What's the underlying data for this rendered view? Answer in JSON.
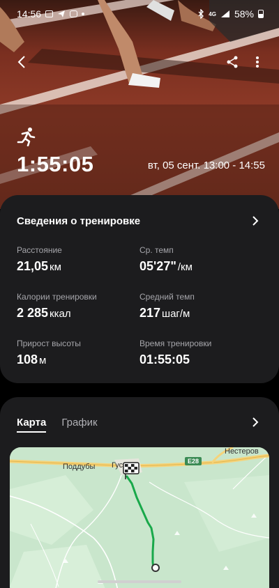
{
  "status_bar": {
    "time": "14:56",
    "signal_text": "4G",
    "battery_percent": "58%"
  },
  "header": {
    "back_icon": "back-arrow-icon",
    "share_icon": "share-icon",
    "more_icon": "more-vertical-icon",
    "activity_icon": "running-icon"
  },
  "workout": {
    "duration": "1:55:05",
    "datetime": "вт, 05 сент. 13:00 - 14:55"
  },
  "summary": {
    "title": "Сведения о тренировке",
    "stats": [
      {
        "label": "Расстояние",
        "value": "21,05",
        "unit": "км"
      },
      {
        "label": "Ср. темп",
        "value": "05'27\"",
        "unit": "/км"
      },
      {
        "label": "Калории тренировки",
        "value": "2 285",
        "unit": "ккал"
      },
      {
        "label": "Средний темп",
        "value": "217",
        "unit": "шаг/м"
      },
      {
        "label": "Прирост высоты",
        "value": "108",
        "unit": "м"
      },
      {
        "label": "Время тренировки",
        "value": "01:55:05",
        "unit": ""
      }
    ]
  },
  "map_card": {
    "tabs": [
      {
        "label": "Карта",
        "active": true
      },
      {
        "label": "График",
        "active": false
      }
    ],
    "places": {
      "poddubi": "Поддубы",
      "gus": "Гус",
      "nesterov": "Нестеров"
    },
    "road": "E28"
  },
  "colors": {
    "card_bg": "#1c1c1e",
    "route": "#19a84a",
    "map_bg": "#c9e6cc",
    "road": "#f5d37a"
  }
}
